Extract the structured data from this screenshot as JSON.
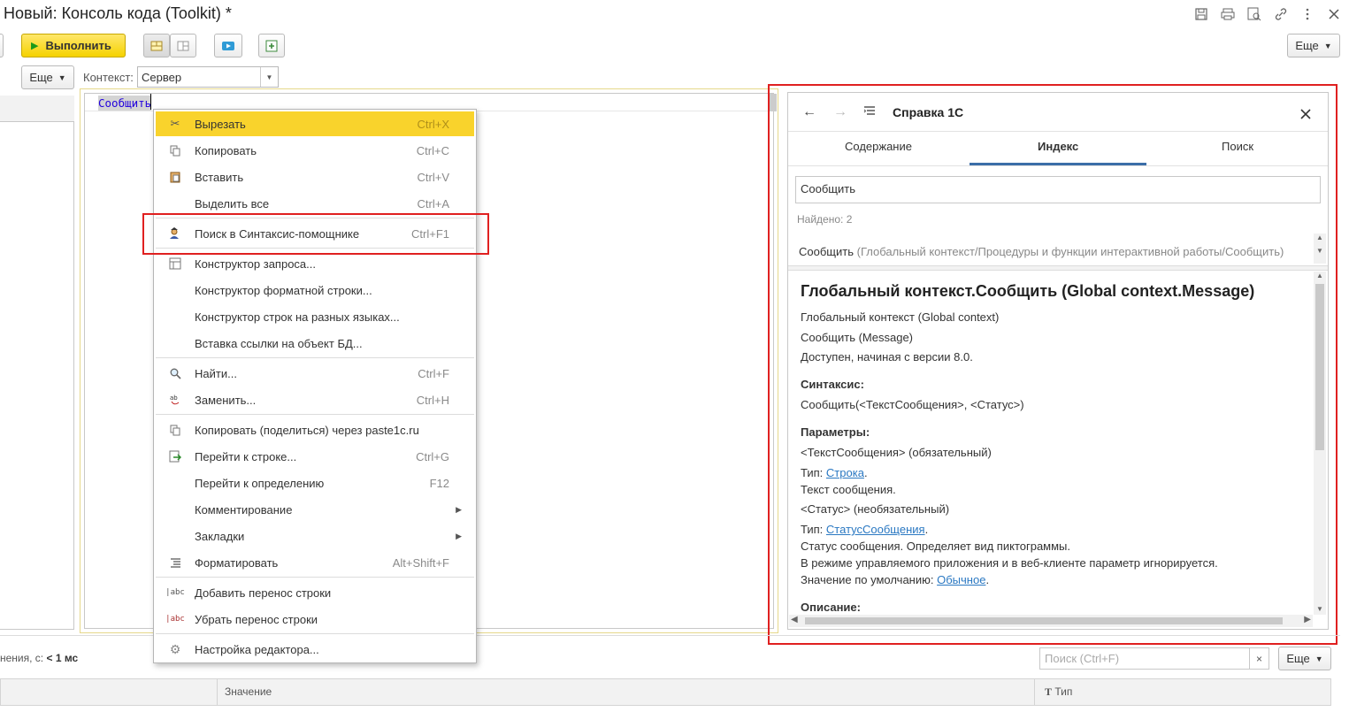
{
  "window": {
    "title": "Новый: Консоль кода (Toolkit) *"
  },
  "toolbar": {
    "run_label": "Выполнить",
    "more_label": "Еще",
    "context_more_label": "Еще",
    "context_label": "Контекст:",
    "context_value": "Сервер"
  },
  "editor": {
    "code_text": "Сообщить"
  },
  "context_menu": {
    "items": [
      {
        "label": "Вырезать",
        "shortcut": "Ctrl+X",
        "icon": "scissors-icon"
      },
      {
        "label": "Копировать",
        "shortcut": "Ctrl+C",
        "icon": "copy-icon"
      },
      {
        "label": "Вставить",
        "shortcut": "Ctrl+V",
        "icon": "paste-icon"
      },
      {
        "label": "Выделить все",
        "shortcut": "Ctrl+A",
        "icon": ""
      },
      {
        "label": "Поиск в Синтаксис-помощнике",
        "shortcut": "Ctrl+F1",
        "icon": "syntax-helper-icon"
      },
      {
        "label": "Конструктор запроса...",
        "shortcut": "",
        "icon": "query-builder-icon"
      },
      {
        "label": "Конструктор форматной строки...",
        "shortcut": "",
        "icon": ""
      },
      {
        "label": "Конструктор строк на разных языках...",
        "shortcut": "",
        "icon": ""
      },
      {
        "label": "Вставка ссылки на объект БД...",
        "shortcut": "",
        "icon": ""
      },
      {
        "label": "Найти...",
        "shortcut": "Ctrl+F",
        "icon": "search-icon"
      },
      {
        "label": "Заменить...",
        "shortcut": "Ctrl+H",
        "icon": "replace-icon"
      },
      {
        "label": "Копировать (поделиться) через paste1c.ru",
        "shortcut": "",
        "icon": "share-copy-icon"
      },
      {
        "label": "Перейти к строке...",
        "shortcut": "Ctrl+G",
        "icon": "goto-line-icon"
      },
      {
        "label": "Перейти к определению",
        "shortcut": "F12",
        "icon": ""
      },
      {
        "label": "Комментирование",
        "shortcut": "",
        "icon": ""
      },
      {
        "label": "Закладки",
        "shortcut": "",
        "icon": ""
      },
      {
        "label": "Форматировать",
        "shortcut": "Alt+Shift+F",
        "icon": "format-icon"
      },
      {
        "label": "Добавить перенос строки",
        "shortcut": "",
        "icon": "add-wrap-icon"
      },
      {
        "label": "Убрать перенос строки",
        "shortcut": "",
        "icon": "remove-wrap-icon"
      },
      {
        "label": "Настройка редактора...",
        "shortcut": "",
        "icon": "gear-icon"
      }
    ]
  },
  "help": {
    "title": "Справка 1С",
    "tabs": [
      "Содержание",
      "Индекс",
      "Поиск"
    ],
    "active_tab": "Индекс",
    "search_value": "Сообщить",
    "found_text": "Найдено: 2",
    "result_name": "Сообщить",
    "result_path": "(Глобальный контекст/Процедуры и функции интерактивной работы/Сообщить)",
    "heading": "Глобальный контекст.Сообщить (Global context.Message)",
    "line_context": "Глобальный контекст (Global context)",
    "line_method": "Сообщить (Message)",
    "line_version": "Доступен, начиная с версии 8.0.",
    "syntax_header": "Синтаксис:",
    "syntax_text": "Сообщить(<ТекстСообщения>, <Статус>)",
    "params_header": "Параметры:",
    "param1": "<ТекстСообщения> (обязательный)",
    "type_label": "Тип:",
    "param1_type": "Строка",
    "param1_desc": "Текст сообщения.",
    "param2": "<Статус> (необязательный)",
    "param2_type": "СтатусСообщения",
    "param2_desc1": "Статус сообщения. Определяет вид пиктограммы.",
    "param2_desc2": "В режиме управляемого приложения и в веб-клиенте параметр игнорируется.",
    "default_label": "Значение по умолчанию:",
    "default_value": "Обычное",
    "description_header": "Описание:"
  },
  "bottom": {
    "exec_time_label": "нения, с:",
    "exec_time_value": "< 1 мс",
    "filter_placeholder": "Поиск (Ctrl+F)",
    "more_label": "Еще",
    "col_value": "Значение",
    "col_type": "Тип"
  },
  "colors": {
    "accent_yellow": "#f9d32c",
    "highlight_red": "#e02020",
    "link_blue": "#2a78c2",
    "tab_underline": "#3b6ea8"
  }
}
